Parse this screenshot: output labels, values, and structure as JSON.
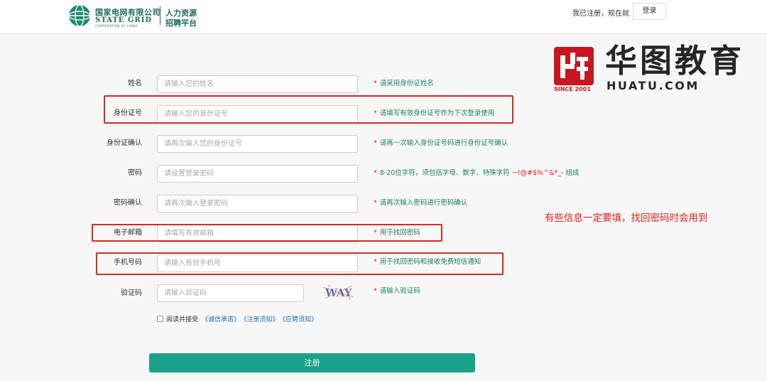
{
  "header": {
    "logo_cn": "国家电网有限公司",
    "logo_en": "STATE GRID",
    "logo_en_sub": "CORPORATION OF CHINA",
    "platform_line1": "人力资源",
    "platform_line2": "招聘平台",
    "registered_text": "我已注册，现在就",
    "login_label": "登录"
  },
  "brand": {
    "name_cn": "华图教育",
    "name_en": "HUATU.COM",
    "since": "SINCE 2001",
    "color": "#c8161e"
  },
  "form": {
    "rows": [
      {
        "label": "姓名",
        "placeholder": "请输入您的姓名",
        "hint": "请采用身份证姓名"
      },
      {
        "label": "身份证号",
        "placeholder": "请输入您的身份证号",
        "hint": "请填写有效身份证号作为下次登录使用"
      },
      {
        "label": "身份证确认",
        "placeholder": "请再次输入您的身份证号",
        "hint": "请再一次输入身份证号码进行身份证号确认"
      },
      {
        "label": "密码",
        "placeholder": "请设置登录密码",
        "hint": "8-20位字符，须包括字母、数字、特殊字符",
        "hint_special": "~!@#$%^&*_-",
        "hint_tail": "组成"
      },
      {
        "label": "密码确认",
        "placeholder": "请再次输入登录密码",
        "hint": "请再次输入密码进行密码确认"
      },
      {
        "label": "电子邮箱",
        "placeholder": "请填写有效邮箱",
        "hint": "用于找回密码"
      },
      {
        "label": "手机号码",
        "placeholder": "请输入有效手机号",
        "hint": "用于找回密码和接收免费短信通知"
      },
      {
        "label": "验证码",
        "placeholder": "请输入验证码",
        "hint": "请输入验证码"
      }
    ],
    "required_mark": "*",
    "captcha_text": "WAY",
    "agree_text": "阅读并接受",
    "agree_links": [
      "《诚信承诺》",
      "《注册须知》",
      "《应聘须知》"
    ],
    "submit_label": "注册"
  },
  "annotation": "有些信息一定要填，找回密码时会用到",
  "colors": {
    "accent": "#1aa289",
    "hint": "#1b7f64",
    "highlight": "#d62a2a"
  }
}
